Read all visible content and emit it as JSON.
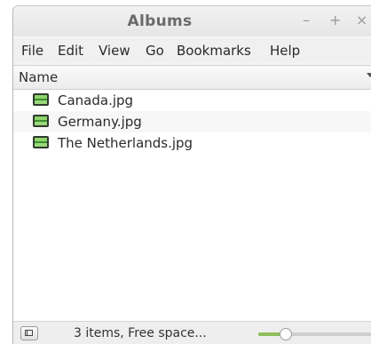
{
  "window": {
    "title": "Albums",
    "controls": {
      "minimize": "–",
      "maximize": "+",
      "close": "×"
    }
  },
  "menu": [
    "File",
    "Edit",
    "View",
    "Go",
    "Bookmarks",
    "Help"
  ],
  "list": {
    "column_header": "Name",
    "files": [
      {
        "name": "Canada.jpg",
        "icon": "image-icon"
      },
      {
        "name": "Germany.jpg",
        "icon": "image-icon"
      },
      {
        "name": "The Netherlands.jpg",
        "icon": "image-icon"
      }
    ]
  },
  "status": {
    "text": "3 items, Free space...",
    "zoom_fraction": 0.24
  },
  "colors": {
    "zoom_fill": "#8dbf5a"
  }
}
